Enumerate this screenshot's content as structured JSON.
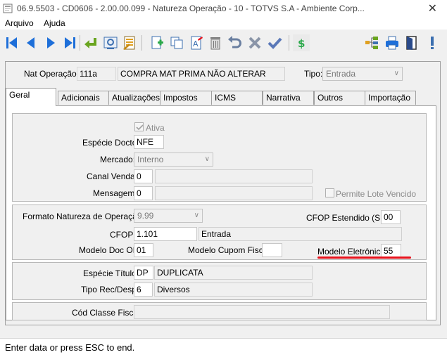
{
  "window": {
    "title": "06.9.5503 - CD0606 - 2.00.00.099 - Natureza Operação - 10 - TOTVS S.A - Ambiente Corp...",
    "close_glyph": "✕"
  },
  "menu": {
    "items": [
      "Arquivo",
      "Ajuda"
    ]
  },
  "header": {
    "nat_label": "Nat Operação:",
    "nat_code": "111a",
    "nat_desc": "COMPRA MAT PRIMA NÃO ALTERAR",
    "tipo_label": "Tipo:",
    "tipo_value": "Entrada"
  },
  "tabs": [
    "Geral",
    "Adicionais",
    "Atualizações",
    "Impostos",
    "ICMS",
    "Narrativa",
    "Outros",
    "Importação"
  ],
  "geral": {
    "ativa_label": "Ativa",
    "especie_docto_label": "Espécie Docto:",
    "especie_docto_value": "NFE",
    "mercado_label": "Mercado:",
    "mercado_value": "Interno",
    "canal_venda_label": "Canal Venda:",
    "canal_venda_value": "0",
    "mensagem_label": "Mensagem:",
    "mensagem_value": "0",
    "permite_lote_label": "Permite Lote Vencido",
    "formato_label": "Formato Natureza de Operação:",
    "formato_value": "9.99",
    "cfop_estendido_label": "CFOP Estendido (SE):",
    "cfop_estendido_value": "00",
    "cfop_label": "CFOP:",
    "cfop_value": "1.101",
    "cfop_desc": "Entrada",
    "modelo_doc_label": "Modelo Doc OF:",
    "modelo_doc_value": "01",
    "modelo_cupom_label": "Modelo Cupom Fiscal:",
    "modelo_cupom_value": "",
    "modelo_eletronico_label": "Modelo Eletrônico:",
    "modelo_eletronico_value": "55",
    "especie_titulo_label": "Espécie Título:",
    "especie_titulo_code": "DP",
    "especie_titulo_desc": "DUPLICATA",
    "tipo_rec_label": "Tipo Rec/Desp:",
    "tipo_rec_code": "6",
    "tipo_rec_desc": "Diversos",
    "cod_classe_label": "Cód Classe Fiscal:",
    "cod_classe_value": ""
  },
  "status": {
    "text": "Enter data or press ESC to end."
  },
  "colors": {
    "accent_blue": "#1e6fd9",
    "highlight_red": "#e8121c",
    "green_dollar": "#2aa84a"
  },
  "toolbar_icons": [
    "first-record-icon",
    "prev-record-icon",
    "next-record-icon",
    "last-record-icon",
    "go-to-icon",
    "search-icon",
    "list-icon",
    "new-icon",
    "copy-icon",
    "edit-icon",
    "delete-icon",
    "undo-icon",
    "cancel-icon",
    "confirm-icon",
    "dollar-icon",
    "tree-icon",
    "print-icon",
    "exit-icon",
    "help-icon"
  ]
}
